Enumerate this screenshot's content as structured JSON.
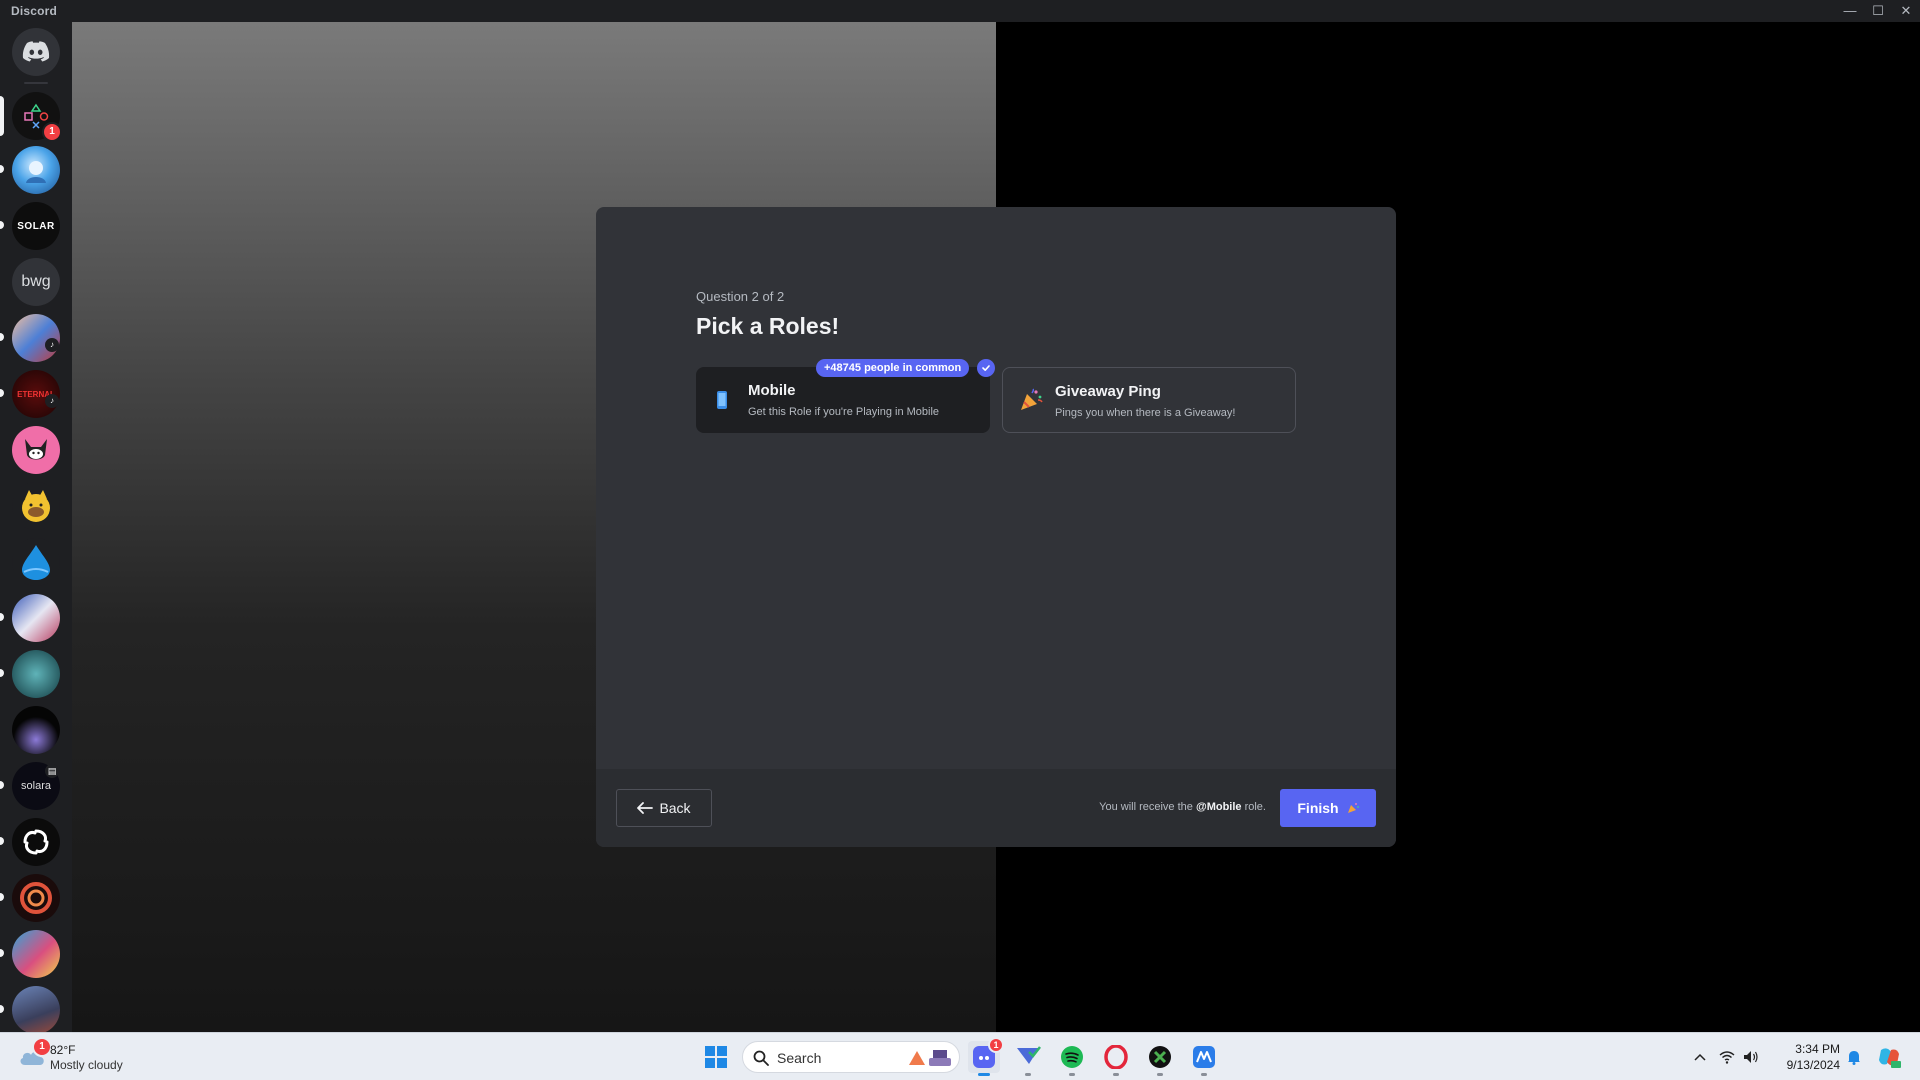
{
  "titlebar": {
    "app_name": "Discord",
    "minimize": "—",
    "maximize": "☐",
    "close": "✕"
  },
  "sidebar": {
    "servers": [
      {
        "name": "home",
        "label": ""
      },
      {
        "name": "playstation",
        "label": "",
        "badge": "1"
      },
      {
        "name": "ice-avatar",
        "label": ""
      },
      {
        "name": "solar",
        "label": "SOLAR"
      },
      {
        "name": "bwg",
        "label": "bwg"
      },
      {
        "name": "anime-1",
        "label": ""
      },
      {
        "name": "eternal",
        "label": "ETERNAL"
      },
      {
        "name": "kuromi",
        "label": ""
      },
      {
        "name": "cat",
        "label": ""
      },
      {
        "name": "droplet",
        "label": ""
      },
      {
        "name": "anime-2",
        "label": ""
      },
      {
        "name": "teal",
        "label": ""
      },
      {
        "name": "dark-orb",
        "label": ""
      },
      {
        "name": "solara",
        "label": "solara"
      },
      {
        "name": "spiral-black",
        "label": ""
      },
      {
        "name": "spiral-red",
        "label": ""
      },
      {
        "name": "game-art",
        "label": ""
      },
      {
        "name": "fighter",
        "label": ""
      }
    ]
  },
  "modal": {
    "question_number": "Question 2 of 2",
    "title": "Pick a Roles!",
    "roles": [
      {
        "name": "Mobile",
        "description": "Get this Role if you're Playing in Mobile",
        "selected": true,
        "icon": "phone-icon"
      },
      {
        "name": "Giveaway Ping",
        "description": "Pings you when there is a Giveaway!",
        "selected": false,
        "icon": "party-popper-icon"
      }
    ],
    "people_in_common": "+48745 people in common",
    "footer": {
      "back_label": "Back",
      "receive_prefix": "You will receive the ",
      "receive_role": "@Mobile",
      "receive_suffix": " role.",
      "finish_label": "Finish"
    }
  },
  "taskbar": {
    "weather_temp": "82°F",
    "weather_condition": "Mostly cloudy",
    "weather_badge": "1",
    "search_placeholder": "Search",
    "discord_badge": "1",
    "time": "3:34 PM",
    "date": "9/13/2024"
  },
  "colors": {
    "accent": "#5865f2",
    "modal_bg": "#313338",
    "footer_bg": "#2b2d31"
  }
}
